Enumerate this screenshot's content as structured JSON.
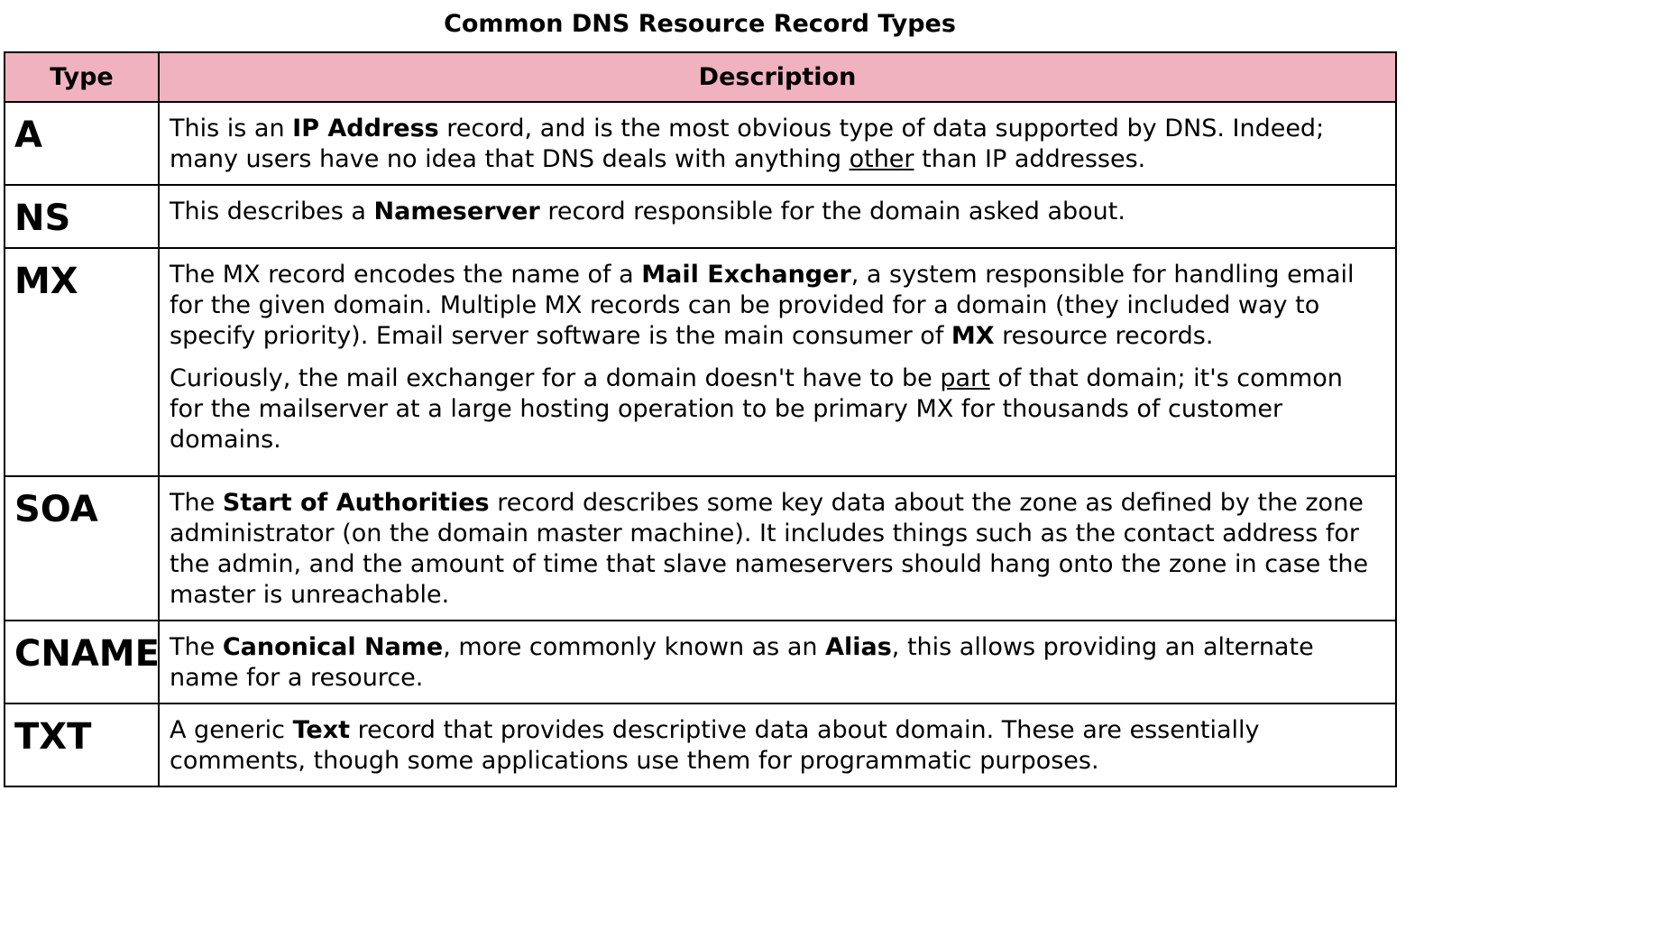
{
  "title": "Common DNS Resource Record Types",
  "headers": {
    "type": "Type",
    "description": "Description"
  },
  "rows": [
    {
      "type": "A",
      "paragraphs": [
        [
          {
            "t": "This is an "
          },
          {
            "t": "IP Address",
            "b": true
          },
          {
            "t": " record, and is the most obvious type of data supported by DNS. Indeed; many users have no idea that DNS deals with anything "
          },
          {
            "t": "other",
            "u": true
          },
          {
            "t": " than IP addresses."
          }
        ]
      ]
    },
    {
      "type": "NS",
      "paragraphs": [
        [
          {
            "t": "This describes a "
          },
          {
            "t": "Nameserver",
            "b": true
          },
          {
            "t": " record responsible for the domain asked about."
          }
        ]
      ]
    },
    {
      "type": "MX",
      "paragraphs": [
        [
          {
            "t": "The MX record encodes the name of a "
          },
          {
            "t": "Mail Exchanger",
            "b": true
          },
          {
            "t": ", a system responsible for handling email for the given domain. Multiple MX records can be provided for a domain (they included way to specify priority). Email server software is the main consumer of "
          },
          {
            "t": "MX",
            "b": true
          },
          {
            "t": " resource records."
          }
        ],
        [
          {
            "t": "Curiously, the mail exchanger for a domain doesn't have to be "
          },
          {
            "t": "part",
            "u": true
          },
          {
            "t": " of that domain; it's common for the mailserver at a large hosting operation to be primary MX for thousands of customer domains."
          }
        ]
      ]
    },
    {
      "type": "SOA",
      "paragraphs": [
        [
          {
            "t": "The "
          },
          {
            "t": "Start of Authorities",
            "b": true
          },
          {
            "t": " record describes some key data about the zone as defined by the zone administrator (on the domain master machine). It includes things such as the contact address for the admin, and the amount of time that slave nameservers should hang onto the zone in case the master is unreachable."
          }
        ]
      ]
    },
    {
      "type": "CNAME",
      "paragraphs": [
        [
          {
            "t": "The "
          },
          {
            "t": "Canonical Name",
            "b": true
          },
          {
            "t": ", more commonly known as an "
          },
          {
            "t": "Alias",
            "b": true
          },
          {
            "t": ", this allows providing an alternate name for a resource."
          }
        ]
      ]
    },
    {
      "type": "TXT",
      "paragraphs": [
        [
          {
            "t": "A generic "
          },
          {
            "t": "Text",
            "b": true
          },
          {
            "t": " record that provides descriptive data about domain. These are essentially comments, though some applications use them for programmatic purposes."
          }
        ]
      ]
    }
  ]
}
